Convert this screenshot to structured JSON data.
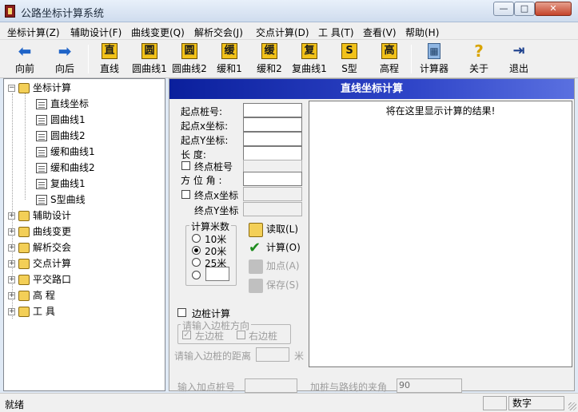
{
  "window": {
    "title": "公路坐标计算系统",
    "min_label": "—",
    "max_label": "□",
    "close_label": "✕"
  },
  "menu": [
    {
      "label": "坐标计算(Z)"
    },
    {
      "label": "辅助设计(F)"
    },
    {
      "label": "曲线变更(Q)"
    },
    {
      "label": "解析交会(J)"
    },
    {
      "label": "交点计算(D)"
    },
    {
      "label": "工 具(T)"
    },
    {
      "label": "查看(V)"
    },
    {
      "label": "帮助(H)"
    }
  ],
  "toolbar": [
    {
      "label": "向前",
      "icon": "arrow-left-icon",
      "glyph": "⬅"
    },
    {
      "label": "向后",
      "icon": "arrow-right-icon",
      "glyph": "➡"
    },
    {
      "label": "直线",
      "icon": "line-char-icon",
      "glyph": "直"
    },
    {
      "label": "圆曲线1",
      "icon": "circle-curve-char-icon",
      "glyph": "圆"
    },
    {
      "label": "圆曲线2",
      "icon": "circle-curve-char-icon",
      "glyph": "圆"
    },
    {
      "label": "缓和1",
      "icon": "transition-char-icon",
      "glyph": "缓"
    },
    {
      "label": "缓和2",
      "icon": "transition-char-icon",
      "glyph": "缓"
    },
    {
      "label": "复曲线1",
      "icon": "compound-char-icon",
      "glyph": "复"
    },
    {
      "label": "S型",
      "icon": "s-curve-char-icon",
      "glyph": "S"
    },
    {
      "label": "高程",
      "icon": "elevation-char-icon",
      "glyph": "高"
    },
    {
      "label": "计算器",
      "icon": "calculator-icon",
      "glyph": "▦"
    },
    {
      "label": "关于",
      "icon": "help-icon",
      "glyph": "?"
    },
    {
      "label": "退出",
      "icon": "exit-icon",
      "glyph": "⇥"
    }
  ],
  "tree": {
    "root": {
      "label": "坐标计算",
      "expander": "−"
    },
    "children": [
      {
        "label": "直线坐标"
      },
      {
        "label": "圆曲线1"
      },
      {
        "label": "圆曲线2"
      },
      {
        "label": "缓和曲线1"
      },
      {
        "label": "缓和曲线2"
      },
      {
        "label": "复曲线1"
      },
      {
        "label": "S型曲线"
      }
    ],
    "others": [
      {
        "label": "辅助设计",
        "expander": "+"
      },
      {
        "label": "曲线变更",
        "expander": "+"
      },
      {
        "label": "解析交会",
        "expander": "+"
      },
      {
        "label": "交点计算",
        "expander": "+"
      },
      {
        "label": "平交路口",
        "expander": "+"
      },
      {
        "label": "高 程",
        "expander": "+"
      },
      {
        "label": "工 具",
        "expander": "+"
      }
    ]
  },
  "panel": {
    "title": "直线坐标计算",
    "result_placeholder": "将在这里显示计算的结果!",
    "fields": {
      "start_station": "起点桩号:",
      "start_x": "起点x坐标:",
      "start_y": "起点Y坐标:",
      "length": "长    度:",
      "end_station_check": "终点桩号",
      "azimuth": "方 位 角 :",
      "end_x_check": "终点x坐标",
      "end_y": "终点Y坐标"
    },
    "interval_group": {
      "title": "计算米数",
      "options": [
        "10米",
        "20米",
        "25米"
      ],
      "selected": "20米"
    },
    "actions": {
      "read": "读取(L)",
      "calc": "计算(O)",
      "add_point": "加点(A)",
      "save": "保存(S)"
    },
    "side_pile": {
      "check_label": "边桩计算",
      "direction_title": "请输入边桩方向",
      "left": "左边桩",
      "right": "右边桩",
      "distance_label": "请输入边桩的距离",
      "distance_unit": "米"
    },
    "add_station_label": "输入加点桩号",
    "angle_label": "加桩与路线的夹角",
    "angle_value": "90"
  },
  "status": {
    "text": "就绪",
    "mode": "数字"
  }
}
